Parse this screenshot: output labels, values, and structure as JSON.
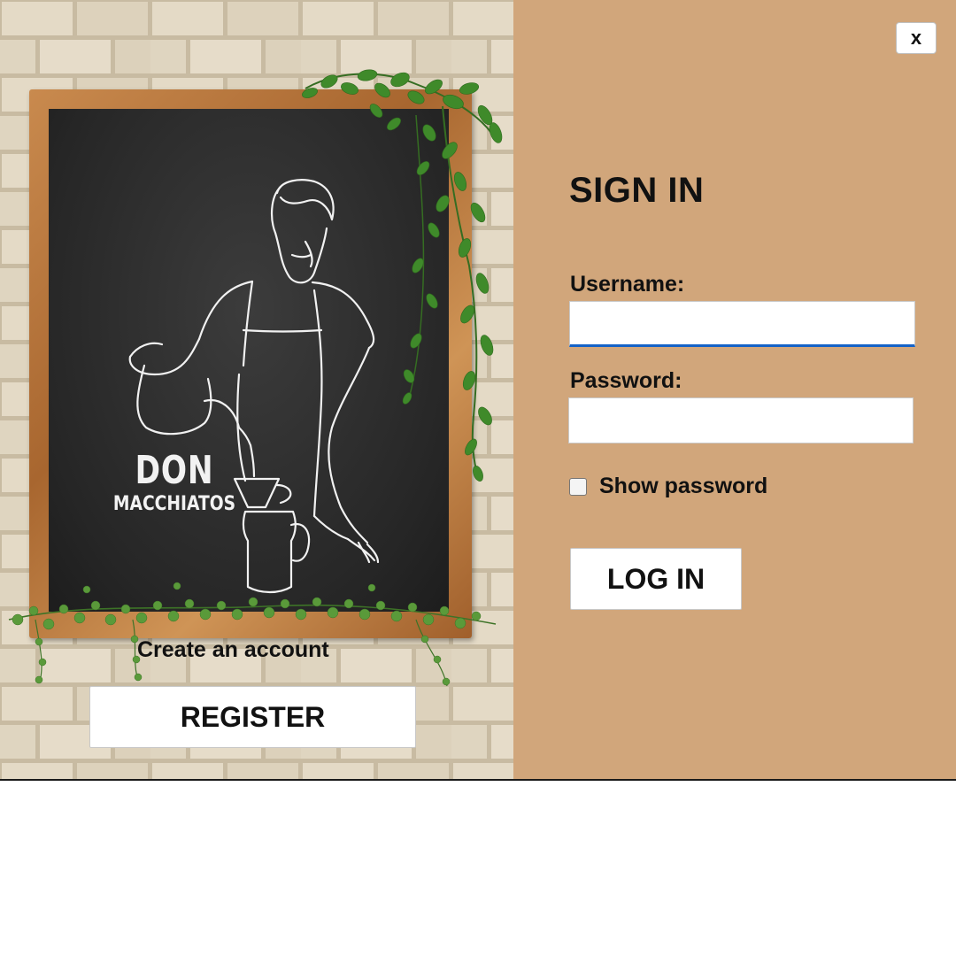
{
  "window": {
    "close_label": "x",
    "background_color": "#d1a67b"
  },
  "branding": {
    "name_top": "DON",
    "name_bottom": "MACCHIATOS"
  },
  "left_panel": {
    "create_account_text": "Create an account",
    "register_label": "REGISTER"
  },
  "form": {
    "title": "SIGN IN",
    "username_label": "Username:",
    "username_value": "",
    "password_label": "Password:",
    "password_value": "",
    "show_password_label": "Show password",
    "show_password_checked": false,
    "login_label": "LOG IN"
  },
  "colors": {
    "focus_accent": "#1462c7",
    "panel_tan": "#d1a67b",
    "chalkboard": "#262626"
  }
}
